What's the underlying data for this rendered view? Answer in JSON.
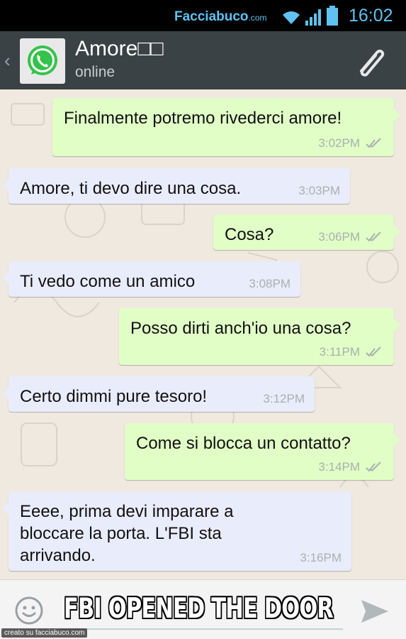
{
  "status_bar": {
    "brand": "Facciabuco",
    "brand_suffix": ".com",
    "time": "16:02"
  },
  "header": {
    "contact_name": "Amore□□",
    "contact_status": "online"
  },
  "messages": [
    {
      "direction": "out",
      "text": "Finalmente potremo rivederci amore!",
      "time": "3:02PM"
    },
    {
      "direction": "in",
      "text": "Amore, ti devo dire una cosa.",
      "time": "3:03PM"
    },
    {
      "direction": "out",
      "text": "Cosa?",
      "time": "3:06PM"
    },
    {
      "direction": "in",
      "text": "Ti vedo come un amico",
      "time": "3:08PM"
    },
    {
      "direction": "out",
      "text": "Posso dirti anch'io una cosa?",
      "time": "3:11PM"
    },
    {
      "direction": "in",
      "text": "Certo dimmi pure tesoro!",
      "time": "3:12PM"
    },
    {
      "direction": "out",
      "text": "Come si blocca un contatto?",
      "time": "3:14PM"
    },
    {
      "direction": "in",
      "text": "Eeee, prima devi imparare a\nbloccare la porta. L'FBI sta\narrivando.",
      "time": "3:16PM"
    }
  ],
  "footer": {
    "caption": "FBI OPENED THE DOOR",
    "watermark": "creato su facciabuco.com"
  },
  "colors": {
    "outgoing_bubble": "#e1fec6",
    "incoming_bubble": "#e9ecfa",
    "header_bg": "#3a4246",
    "status_accent": "#5fc2f0"
  },
  "icons": [
    "wifi-icon",
    "signal-icon",
    "battery-icon",
    "back-chevron-icon",
    "whatsapp-logo-icon",
    "paperclip-icon",
    "read-ticks-icon",
    "emoji-icon",
    "send-icon"
  ]
}
